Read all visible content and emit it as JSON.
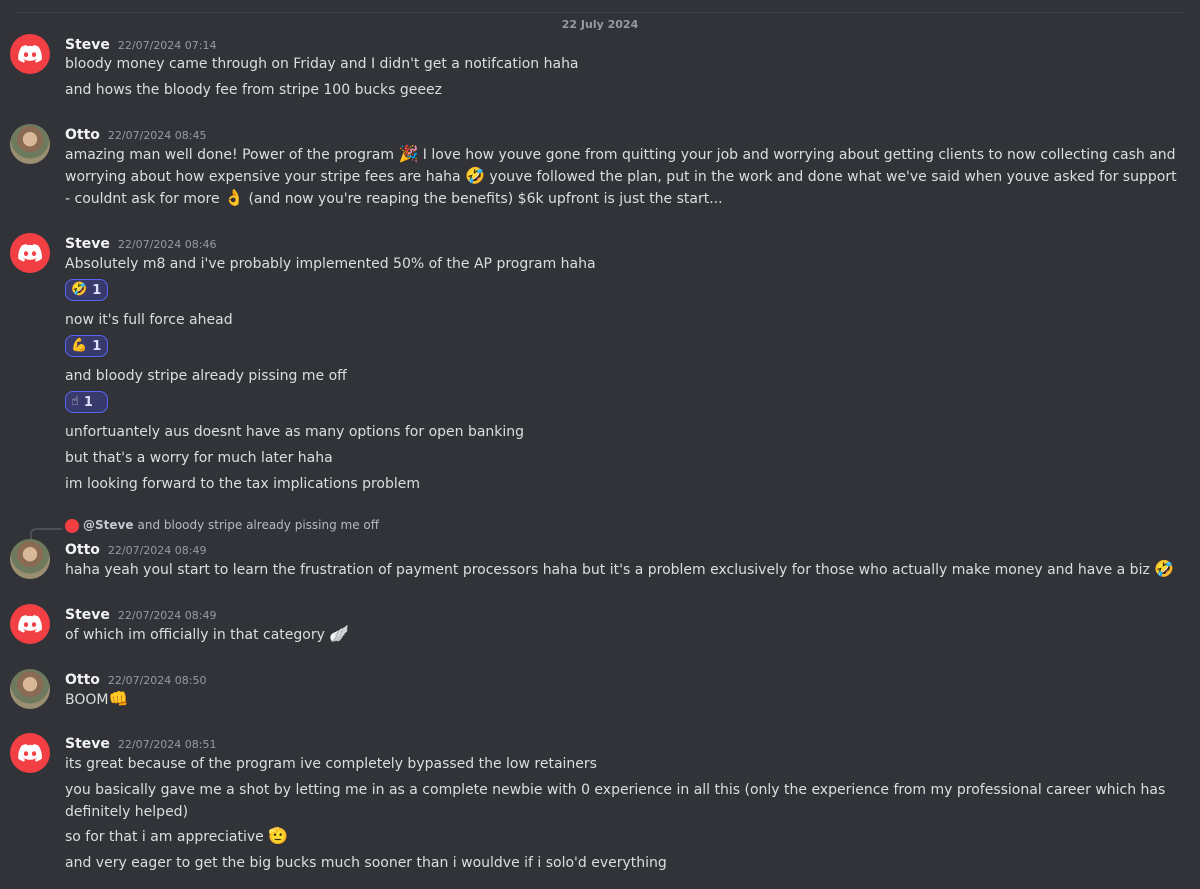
{
  "date_divider": "22 July 2024",
  "messages": [
    {
      "author": "Steve",
      "time": "22/07/2024 07:14",
      "lines": [
        "bloody money came through on Friday and I didn't get a notifcation haha",
        "and hows the bloody fee from stripe 100 bucks geeez"
      ]
    },
    {
      "author": "Otto",
      "time": "22/07/2024 08:45",
      "text": [
        "amazing man well done! Power of the program ",
        "🎉",
        " I love how youve gone from quitting your job and worrying about getting clients to now collecting cash and worrying about how expensive your stripe fees are haha ",
        "🤣",
        " youve followed the plan, put in the work and done what we've said when youve asked for support - couldnt ask for more ",
        "👌",
        " (and now you're reaping the benefits) $6k upfront is just the start..."
      ]
    },
    {
      "author": "Steve",
      "time": "22/07/2024 08:46",
      "lines": [
        "Absolutely m8 and i've probably implemented 50% of the AP program haha",
        "now it's full force ahead",
        "and bloody stripe already pissing me off",
        "unfortuantely aus doesnt have as many options for open banking",
        "but that's a worry for much later haha",
        "im looking forward to the tax implications problem"
      ],
      "reactions": [
        {
          "emoji": "🤣",
          "count": "1"
        },
        {
          "emoji": "💪",
          "count": "1"
        },
        {
          "emoji": "☝",
          "count": "1"
        }
      ]
    },
    {
      "author": "Otto",
      "time": "22/07/2024 08:49",
      "reply": {
        "name": "@Steve",
        "text": "and bloody stripe already pissing me off"
      },
      "lines": [
        "haha yeah youl start to learn the frustration of payment processors haha but it's a problem exclusively for those who actually make money and have a biz"
      ],
      "emojis": [
        "🤣"
      ]
    },
    {
      "author": "Steve",
      "time": "22/07/2024 08:49",
      "lines": [
        "of which im officially in that category"
      ],
      "emojis": [
        "🪽"
      ]
    },
    {
      "author": "Otto",
      "time": "22/07/2024 08:50",
      "lines": [
        "BOOM"
      ],
      "emojis": [
        "👊"
      ]
    },
    {
      "author": "Steve",
      "time": "22/07/2024 08:51",
      "lines": [
        "its great because of the program ive completely bypassed the low retainers",
        "you basically gave me a shot by letting me in as a complete newbie with 0 experience in all this (only the experience from my professional career which has definitely helped)",
        "so for that i am appreciative",
        "and very eager to get the big bucks much sooner than i wouldve if i solo'd everything"
      ],
      "emojis": [
        "🫡"
      ]
    }
  ],
  "colors": {
    "background": "#313338",
    "avatar_red": "#f23f43",
    "reaction_border": "#5865f2"
  },
  "icons": {
    "steve_avatar": "discord-logo-icon"
  }
}
